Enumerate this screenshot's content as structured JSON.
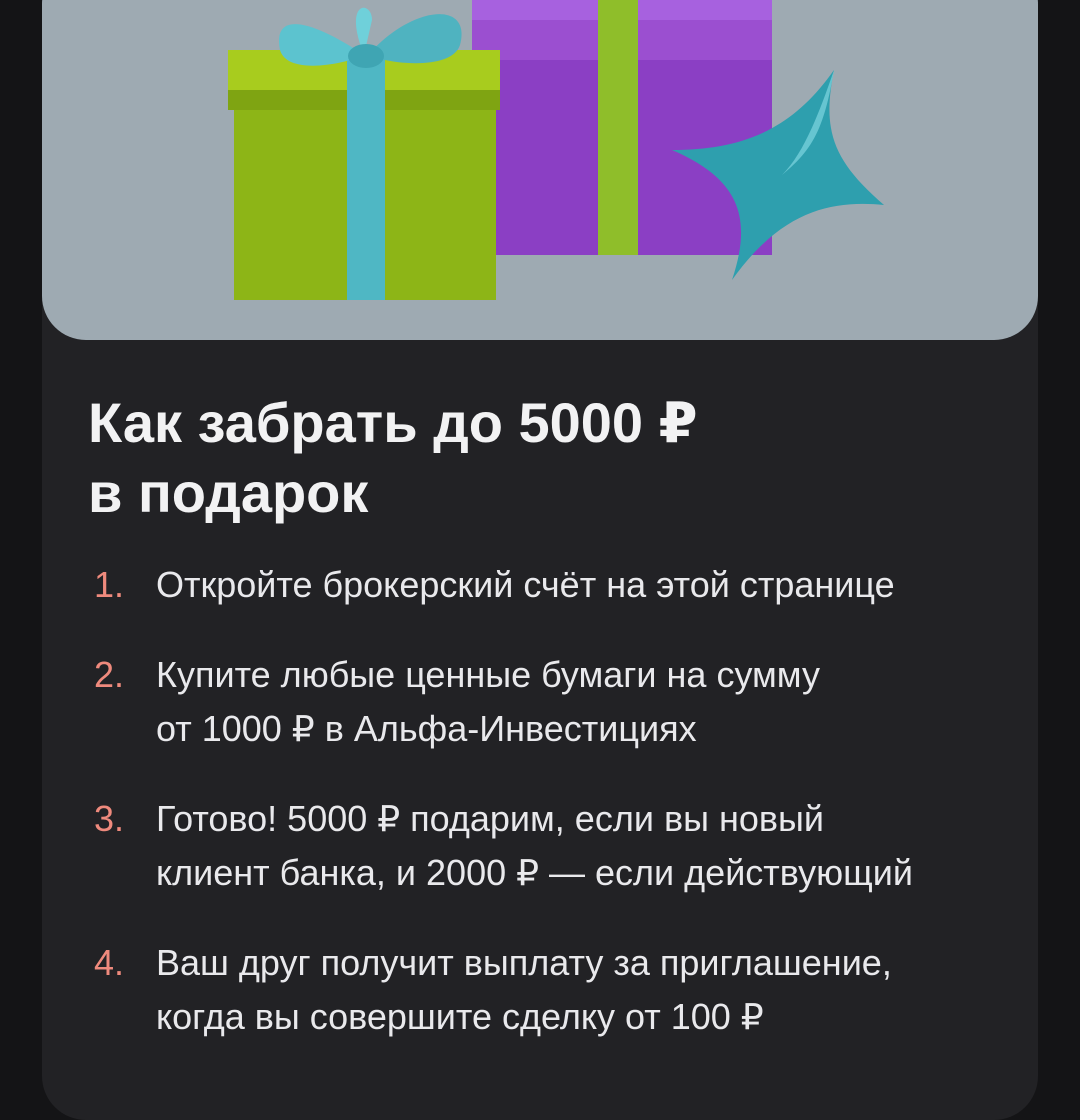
{
  "hero": {
    "illustration": "gift-boxes-with-star",
    "colors": {
      "background": "#9eaab2",
      "green_box": "#9cc21b",
      "purple_box": "#9b4fd0",
      "ribbon": "#4fb7c4",
      "star": "#2e9fae"
    }
  },
  "title": {
    "line1": "Как забрать до 5000 ₽",
    "line2": "в подарок"
  },
  "steps": [
    {
      "number": "1.",
      "lines": [
        "Откройте брокерский счёт на этой странице"
      ]
    },
    {
      "number": "2.",
      "lines": [
        "Купите любые ценные бумаги на сумму",
        "от 1000 ₽ в Альфа-Инвестициях"
      ]
    },
    {
      "number": "3.",
      "lines": [
        "Готово! 5000 ₽ подарим, если вы новый",
        "клиент банка, и 2000 ₽ — если действующий"
      ]
    },
    {
      "number": "4.",
      "lines": [
        "Ваш друг получит выплату за приглашение,",
        "когда вы совершите сделку от 100 ₽"
      ]
    }
  ],
  "colors": {
    "page_background": "#141416",
    "card_background": "#222225",
    "title_text": "#f2f2f3",
    "step_text": "#e9e9ec",
    "step_number": "#ef8a7d"
  }
}
